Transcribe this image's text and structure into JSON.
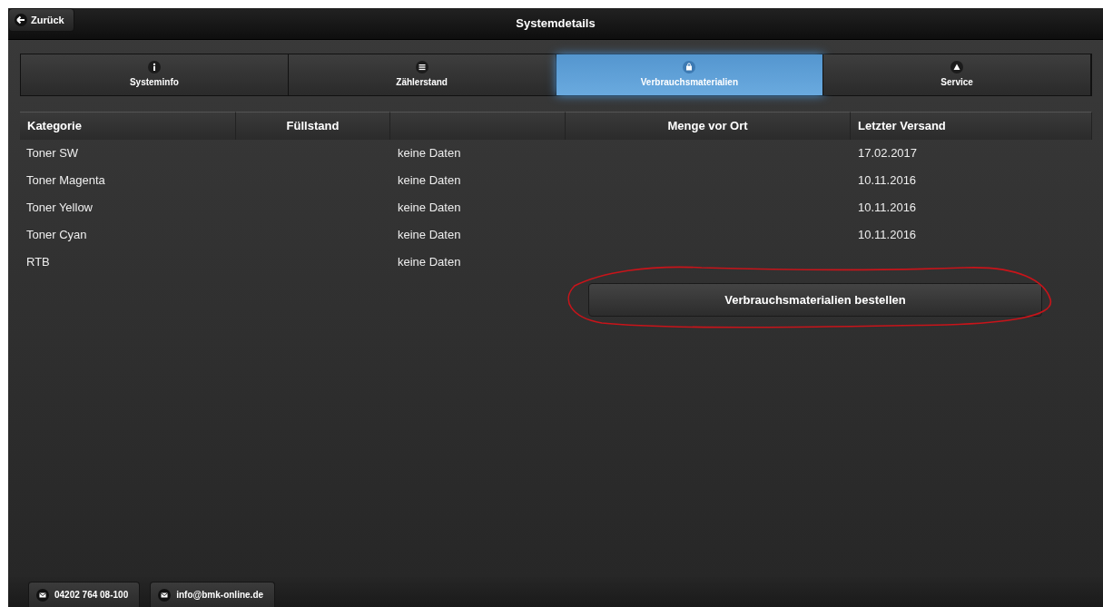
{
  "header": {
    "back_label": "Zurück",
    "title": "Systemdetails"
  },
  "tabs": [
    {
      "label": "Systeminfo",
      "kind": "info",
      "selected": false
    },
    {
      "label": "Zählerstand",
      "kind": "list",
      "selected": false
    },
    {
      "label": "Verbrauchsmaterialien",
      "kind": "supplies",
      "selected": true
    },
    {
      "label": "Service",
      "kind": "alert",
      "selected": false
    }
  ],
  "table": {
    "columns": [
      "Kategorie",
      "Füllstand",
      null,
      "Menge vor Ort",
      "Letzter Versand"
    ],
    "rows": [
      {
        "category": "Toner SW",
        "column_3": "keine Daten",
        "last_shipment": "17.02.2017"
      },
      {
        "category": "Toner Magenta",
        "column_3": "keine Daten",
        "last_shipment": "10.11.2016"
      },
      {
        "category": "Toner Yellow",
        "column_3": "keine Daten",
        "last_shipment": "10.11.2016"
      },
      {
        "category": "Toner Cyan",
        "column_3": "keine Daten",
        "last_shipment": "10.11.2016"
      },
      {
        "category": "RTB",
        "column_3": "keine Daten"
      }
    ]
  },
  "order_button": {
    "label": "Verbrauchsmaterialien bestellen",
    "annotated": true
  },
  "footer": {
    "contacts": [
      {
        "label": "04202 764 08-100"
      },
      {
        "label": "info@bmk-online.de"
      }
    ]
  }
}
